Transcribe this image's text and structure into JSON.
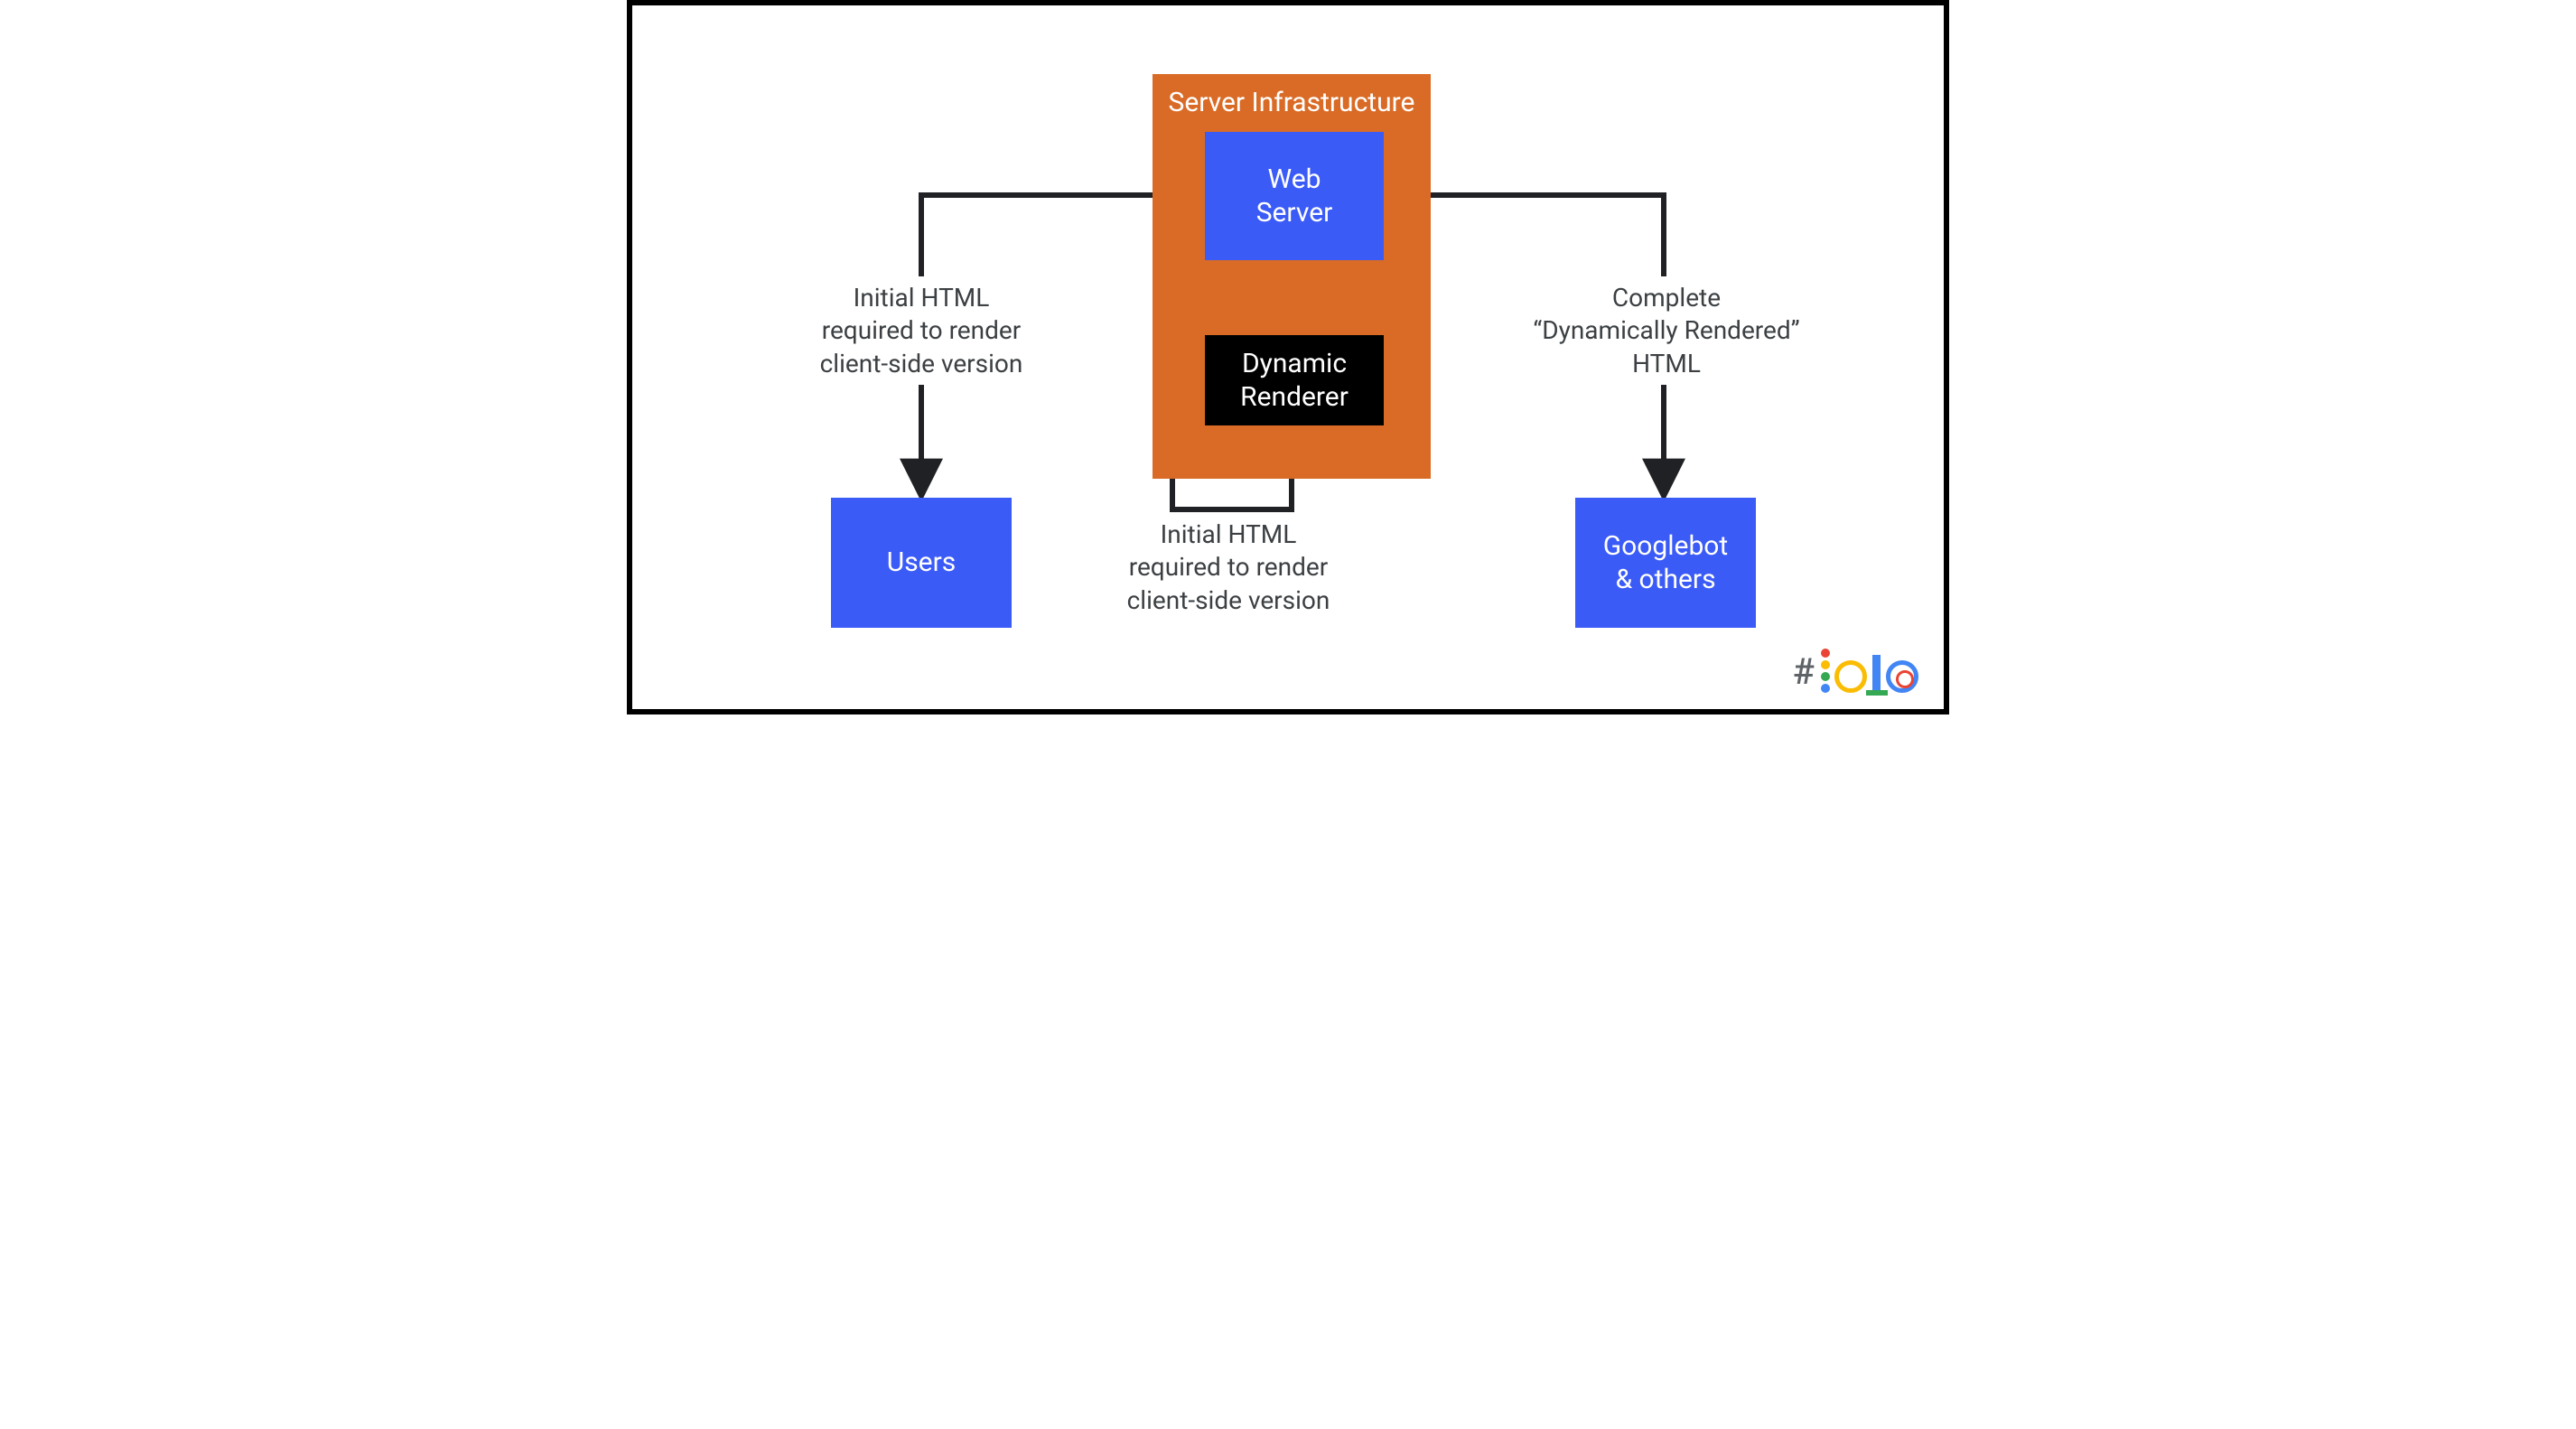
{
  "diagram": {
    "infra_title": "Server Infrastructure",
    "web_server": "Web\nServer",
    "dynamic_renderer": "Dynamic\nRenderer",
    "users": "Users",
    "googlebot": "Googlebot\n& others"
  },
  "labels": {
    "left": "Initial HTML\nrequired to render\nclient-side version",
    "bottom": "Initial HTML\nrequired to render\nclient-side version",
    "right": "Complete\n“Dynamically Rendered”\nHTML"
  },
  "logo": {
    "hash": "#"
  },
  "colors": {
    "blue": "#3b5bf7",
    "orange": "#d96b26",
    "black": "#000000",
    "text": "#3c4043"
  }
}
